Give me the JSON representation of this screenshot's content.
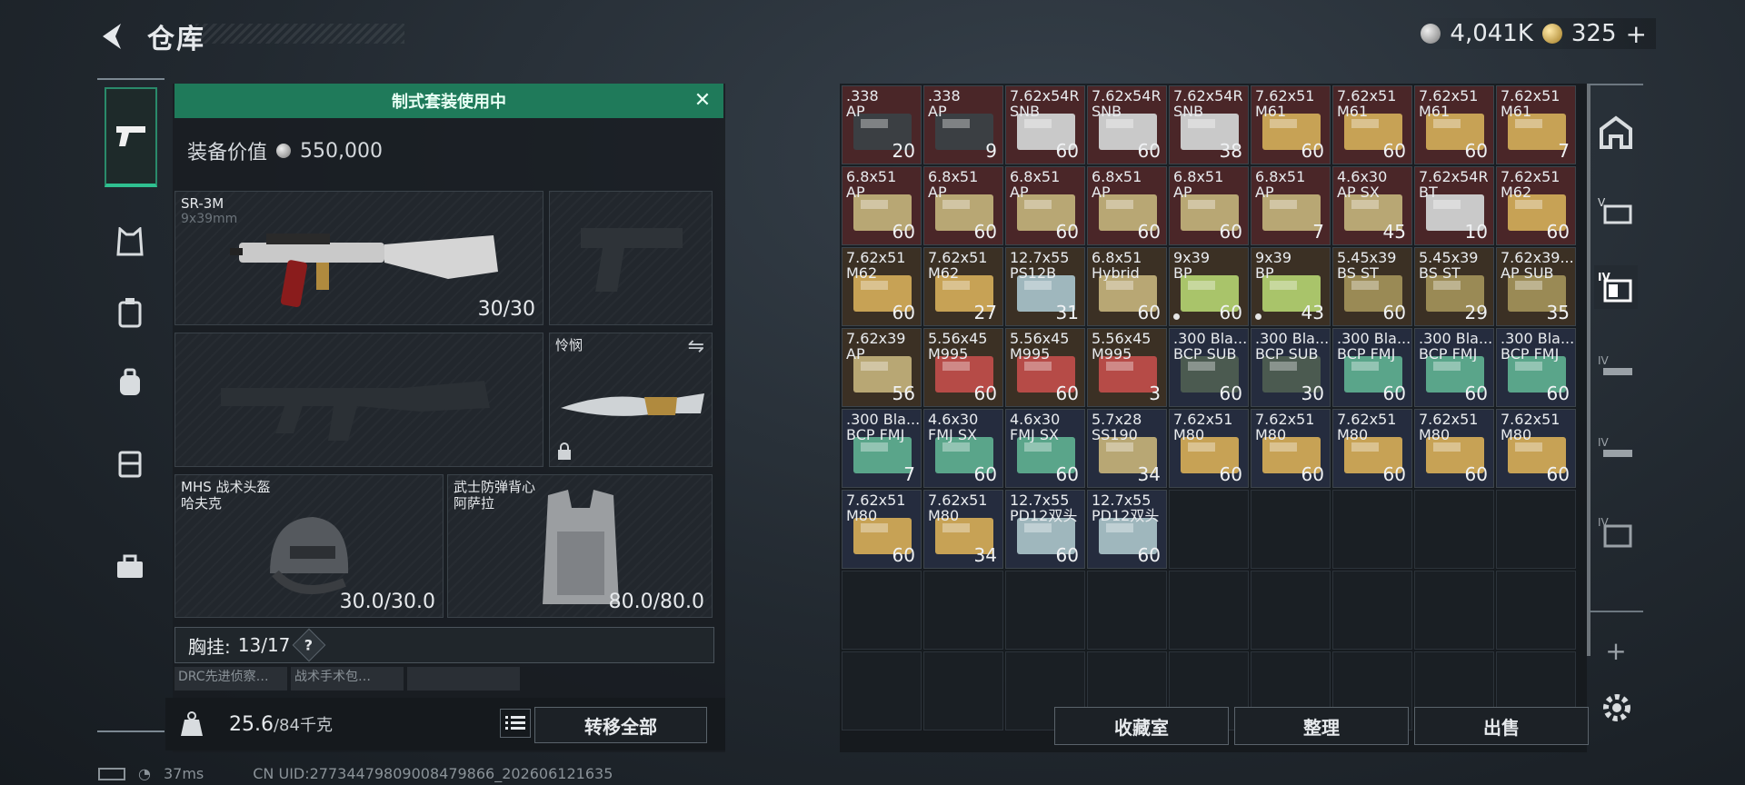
{
  "header": {
    "title": "仓库",
    "silver": "4,041K",
    "gold": "325"
  },
  "left_panel": {
    "banner": "制式套装使用中",
    "equip_value_label": "装备价值",
    "equip_value": "550,000",
    "primary": {
      "name": "SR-3M",
      "sub": "9x39mm",
      "ammo": "30/30"
    },
    "melee": {
      "name": "怜悯"
    },
    "helmet": {
      "name": "MHS 战术头盔",
      "sub": "哈夫克",
      "durability": "30.0/30.0"
    },
    "armor": {
      "name": "武士防弹背心",
      "sub": "阿萨拉",
      "durability": "80.0/80.0"
    },
    "chest_rig": {
      "label": "胸挂:",
      "value": "13/17",
      "help": "?"
    },
    "mini_items": [
      "DRC先进侦察…",
      "战术手术包…",
      ""
    ],
    "weight": "25.6",
    "weight_max": "/84千克",
    "transfer_all": "转移全部"
  },
  "status": {
    "ping": "37ms",
    "uid": "CN UID:27734479809008479866_202606121635"
  },
  "storage": {
    "items": [
      {
        "n": ".338\nAP",
        "q": "20",
        "c": "red",
        "b": "#3b3f43"
      },
      {
        "n": ".338\nAP",
        "q": "9",
        "c": "red",
        "b": "#3b3f43"
      },
      {
        "n": "7.62x54R\nSNB",
        "q": "60",
        "c": "red",
        "b": "#c9c9c9"
      },
      {
        "n": "7.62x54R\nSNB",
        "q": "60",
        "c": "red",
        "b": "#c9c9c9"
      },
      {
        "n": "7.62x54R\nSNB",
        "q": "38",
        "c": "red",
        "b": "#c9c9c9"
      },
      {
        "n": "7.62x51\nM61",
        "q": "60",
        "c": "red",
        "b": "#c7a255"
      },
      {
        "n": "7.62x51\nM61",
        "q": "60",
        "c": "red",
        "b": "#c7a255"
      },
      {
        "n": "7.62x51\nM61",
        "q": "60",
        "c": "red",
        "b": "#c7a255"
      },
      {
        "n": "7.62x51\nM61",
        "q": "7",
        "c": "red",
        "b": "#c7a255"
      },
      {
        "n": "6.8x51\nAP",
        "q": "60",
        "c": "red",
        "b": "#b8a774"
      },
      {
        "n": "6.8x51\nAP",
        "q": "60",
        "c": "red",
        "b": "#b8a774"
      },
      {
        "n": "6.8x51\nAP",
        "q": "60",
        "c": "red",
        "b": "#b8a774"
      },
      {
        "n": "6.8x51\nAP",
        "q": "60",
        "c": "red",
        "b": "#b8a774"
      },
      {
        "n": "6.8x51\nAP",
        "q": "60",
        "c": "red",
        "b": "#b8a774"
      },
      {
        "n": "6.8x51\nAP",
        "q": "7",
        "c": "red",
        "b": "#b8a774"
      },
      {
        "n": "4.6x30\nAP SX",
        "q": "45",
        "c": "red",
        "b": "#b8a774"
      },
      {
        "n": "7.62x54R\nBT",
        "q": "10",
        "c": "red",
        "b": "#c9c9c9"
      },
      {
        "n": "7.62x51\nM62",
        "q": "60",
        "c": "red",
        "b": "#c7a255"
      },
      {
        "n": "7.62x51\nM62",
        "q": "60",
        "c": "brown",
        "b": "#c7a255"
      },
      {
        "n": "7.62x51\nM62",
        "q": "27",
        "c": "brown",
        "b": "#c7a255"
      },
      {
        "n": "12.7x55\nPS12B",
        "q": "31",
        "c": "brown",
        "b": "#9fb7bd"
      },
      {
        "n": "6.8x51\nHybrid",
        "q": "60",
        "c": "brown",
        "b": "#b8a774"
      },
      {
        "n": "9x39\nBP",
        "q": "60",
        "c": "brown",
        "b": "#a9c46a",
        "dot": true
      },
      {
        "n": "9x39\nBP",
        "q": "43",
        "c": "brown",
        "b": "#a9c46a",
        "dot": true
      },
      {
        "n": "5.45x39\nBS ST",
        "q": "60",
        "c": "brown",
        "b": "#9a8a55"
      },
      {
        "n": "5.45x39\nBS ST",
        "q": "29",
        "c": "brown",
        "b": "#9a8a55"
      },
      {
        "n": "7.62x39...\nAP SUB",
        "q": "35",
        "c": "brown",
        "b": "#9a8a55"
      },
      {
        "n": "7.62x39\nAP",
        "q": "56",
        "c": "brown",
        "b": "#b8a774"
      },
      {
        "n": "5.56x45\nM995",
        "q": "60",
        "c": "brown",
        "b": "#b64b47"
      },
      {
        "n": "5.56x45\nM995",
        "q": "60",
        "c": "brown",
        "b": "#b64b47"
      },
      {
        "n": "5.56x45\nM995",
        "q": "3",
        "c": "brown",
        "b": "#b64b47"
      },
      {
        "n": ".300 Bla...\nBCP SUB",
        "q": "60",
        "c": "blue",
        "b": "#4b5a50"
      },
      {
        "n": ".300 Bla...\nBCP SUB",
        "q": "30",
        "c": "blue",
        "b": "#4b5a50"
      },
      {
        "n": ".300 Bla...\nBCP FMJ",
        "q": "60",
        "c": "blue",
        "b": "#5aa58a"
      },
      {
        "n": ".300 Bla...\nBCP FMJ",
        "q": "60",
        "c": "blue",
        "b": "#5aa58a"
      },
      {
        "n": ".300 Bla...\nBCP FMJ",
        "q": "60",
        "c": "blue",
        "b": "#5aa58a"
      },
      {
        "n": ".300 Bla...\nBCP FMJ",
        "q": "7",
        "c": "blue",
        "b": "#5aa58a"
      },
      {
        "n": "4.6x30\nFMJ SX",
        "q": "60",
        "c": "blue",
        "b": "#5aa58a"
      },
      {
        "n": "4.6x30\nFMJ SX",
        "q": "60",
        "c": "blue",
        "b": "#5aa58a"
      },
      {
        "n": "5.7x28\nSS190",
        "q": "34",
        "c": "blue",
        "b": "#b8a774"
      },
      {
        "n": "7.62x51\nM80",
        "q": "60",
        "c": "blue",
        "b": "#c7a255"
      },
      {
        "n": "7.62x51\nM80",
        "q": "60",
        "c": "blue",
        "b": "#c7a255"
      },
      {
        "n": "7.62x51\nM80",
        "q": "60",
        "c": "blue",
        "b": "#c7a255"
      },
      {
        "n": "7.62x51\nM80",
        "q": "60",
        "c": "blue",
        "b": "#c7a255"
      },
      {
        "n": "7.62x51\nM80",
        "q": "60",
        "c": "blue",
        "b": "#c7a255"
      },
      {
        "n": "7.62x51\nM80",
        "q": "60",
        "c": "blue",
        "b": "#c7a255"
      },
      {
        "n": "7.62x51\nM80",
        "q": "34",
        "c": "blue",
        "b": "#c7a255"
      },
      {
        "n": "12.7x55\nPD12双头",
        "q": "60",
        "c": "blue",
        "b": "#9fb7bd"
      },
      {
        "n": "12.7x55\nPD12双头",
        "q": "60",
        "c": "blue",
        "b": "#9fb7bd"
      }
    ],
    "buttons": {
      "vault": "收藏室",
      "sort": "整理",
      "sell": "出售"
    }
  },
  "right_rail": {
    "labels": [
      "IV",
      "IV",
      "IV",
      "IV"
    ],
    "add": "+"
  },
  "colors": {
    "accent_green": "#1f7a5a",
    "red_bg": "#4a2628",
    "brown_bg": "#3b3024",
    "blue_bg": "#252c3e"
  }
}
